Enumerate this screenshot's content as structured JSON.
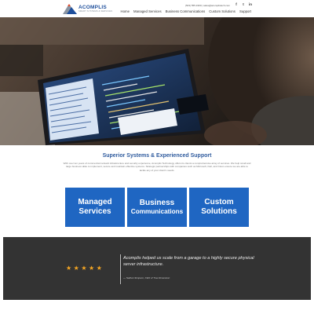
{
  "brand": {
    "name": "ACOMPLIS",
    "tagline": "SMART SYSTEMS & SERVICES",
    "colors": {
      "primary": "#1f66c2",
      "dark": "#333333",
      "star": "#f5a623"
    }
  },
  "header": {
    "contact": "(503) 555-1990  |  sales@acomplistech.com",
    "social": [
      {
        "label": "f",
        "icon": "facebook-icon"
      },
      {
        "label": "t",
        "icon": "twitter-icon"
      },
      {
        "label": "in",
        "icon": "linkedin-icon"
      }
    ],
    "nav": [
      "Home",
      "Managed Services",
      "Business Communications",
      "Custom Solutions",
      "Support"
    ]
  },
  "intro": {
    "heading": "Superior Systems & Experienced Support",
    "body": "With over ten years of commercial network infrastructure and security experience, Acomplis Technology offers its clients a comprehensive array of services. We help small and large business alike to implement, secure and maintain effective systems. Strategic partnerships with companies such as Microsoft, Dell, and Cisco ensure we are able to tackle any of your client's needs."
  },
  "cards": [
    {
      "line1": "Managed",
      "line2": "Services"
    },
    {
      "line1": "Business",
      "line2": "Communications"
    },
    {
      "line1": "Custom",
      "line2": "Solutions"
    }
  ],
  "testimonial": {
    "rating": 5,
    "stars": [
      "★",
      "★",
      "★",
      "★",
      "★"
    ],
    "quote": "Acomplis helped us scale from a garage to a highly secure physical server infrastructure.",
    "attribution": "— Nathan Simpson, CEO of True Dimension"
  }
}
